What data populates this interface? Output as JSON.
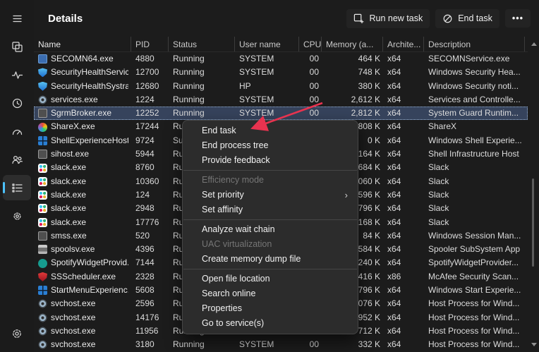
{
  "colors": {
    "accent": "#4cc2ff",
    "selection": "#36435c",
    "annotation_arrow": "#e8334f",
    "menu_bg": "#2c2c2c"
  },
  "header": {
    "title": "Details",
    "run_new_task_label": "Run new task",
    "end_task_label": "End task",
    "more_label": "•••"
  },
  "sidebar": {
    "items": [
      "menu-icon",
      "processes-icon",
      "performance-icon",
      "app-history-icon",
      "startup-apps-icon",
      "users-icon",
      "details-icon",
      "services-icon",
      "settings-icon"
    ],
    "active_item": "details-icon"
  },
  "table": {
    "columns": [
      {
        "key": "name",
        "label": "Name"
      },
      {
        "key": "pid",
        "label": "PID"
      },
      {
        "key": "status",
        "label": "Status"
      },
      {
        "key": "user",
        "label": "User name"
      },
      {
        "key": "cpu",
        "label": "CPU"
      },
      {
        "key": "mem",
        "label": "Memory (a..."
      },
      {
        "key": "arch",
        "label": "Archite..."
      },
      {
        "key": "desc",
        "label": "Description"
      }
    ],
    "rows": [
      {
        "icon": "speaker",
        "name": "SECOMN64.exe",
        "pid": "4880",
        "status": "Running",
        "user": "SYSTEM",
        "cpu": "00",
        "mem": "464 K",
        "arch": "x64",
        "desc": "SECOMNService.exe"
      },
      {
        "icon": "shield",
        "name": "SecurityHealthServic...",
        "pid": "12700",
        "status": "Running",
        "user": "SYSTEM",
        "cpu": "00",
        "mem": "748 K",
        "arch": "x64",
        "desc": "Windows Security Hea..."
      },
      {
        "icon": "shield",
        "name": "SecurityHealthSystra...",
        "pid": "12680",
        "status": "Running",
        "user": "HP",
        "cpu": "00",
        "mem": "380 K",
        "arch": "x64",
        "desc": "Windows Security noti..."
      },
      {
        "icon": "gears",
        "name": "services.exe",
        "pid": "1224",
        "status": "Running",
        "user": "SYSTEM",
        "cpu": "00",
        "mem": "2,612 K",
        "arch": "x64",
        "desc": "Services and Controlle..."
      },
      {
        "icon": "generic",
        "name": "SgrmBroker.exe",
        "pid": "12252",
        "status": "Running",
        "user": "SYSTEM",
        "cpu": "00",
        "mem": "2,812 K",
        "arch": "x64",
        "desc": "System Guard Runtim...",
        "selected": true
      },
      {
        "icon": "sharex",
        "name": "ShareX.exe",
        "pid": "17244",
        "status": "Running",
        "user": "",
        "cpu": "",
        "mem": "808 K",
        "arch": "x64",
        "desc": "ShareX"
      },
      {
        "icon": "window",
        "name": "ShellExperienceHost...",
        "pid": "9724",
        "status": "Suspended",
        "user": "",
        "cpu": "",
        "mem": "0 K",
        "arch": "x64",
        "desc": "Windows Shell Experie..."
      },
      {
        "icon": "generic",
        "name": "sihost.exe",
        "pid": "5944",
        "status": "Running",
        "user": "",
        "cpu": "",
        "mem": "164 K",
        "arch": "x64",
        "desc": "Shell Infrastructure Host"
      },
      {
        "icon": "slack",
        "name": "slack.exe",
        "pid": "8760",
        "status": "Running",
        "user": "",
        "cpu": "",
        "mem": "684 K",
        "arch": "x64",
        "desc": "Slack"
      },
      {
        "icon": "slack",
        "name": "slack.exe",
        "pid": "10360",
        "status": "Running",
        "user": "",
        "cpu": "",
        "mem": "060 K",
        "arch": "x64",
        "desc": "Slack"
      },
      {
        "icon": "slack",
        "name": "slack.exe",
        "pid": "124",
        "status": "Running",
        "user": "",
        "cpu": "",
        "mem": "596 K",
        "arch": "x64",
        "desc": "Slack"
      },
      {
        "icon": "slack",
        "name": "slack.exe",
        "pid": "2948",
        "status": "Running",
        "user": "",
        "cpu": "",
        "mem": "796 K",
        "arch": "x64",
        "desc": "Slack"
      },
      {
        "icon": "slack",
        "name": "slack.exe",
        "pid": "17776",
        "status": "Running",
        "user": "",
        "cpu": "",
        "mem": "168 K",
        "arch": "x64",
        "desc": "Slack"
      },
      {
        "icon": "generic",
        "name": "smss.exe",
        "pid": "520",
        "status": "Running",
        "user": "",
        "cpu": "",
        "mem": "84 K",
        "arch": "x64",
        "desc": "Windows Session Man..."
      },
      {
        "icon": "printer",
        "name": "spoolsv.exe",
        "pid": "4396",
        "status": "Running",
        "user": "",
        "cpu": "",
        "mem": "584 K",
        "arch": "x64",
        "desc": "Spooler SubSystem App"
      },
      {
        "icon": "spotify",
        "name": "SpotifyWidgetProvid...",
        "pid": "7144",
        "status": "Running",
        "user": "",
        "cpu": "",
        "mem": "240 K",
        "arch": "x64",
        "desc": "SpotifyWidgetProvider..."
      },
      {
        "icon": "mcafee",
        "name": "SSScheduler.exe",
        "pid": "2328",
        "status": "Running",
        "user": "",
        "cpu": "",
        "mem": "416 K",
        "arch": "x86",
        "desc": "McAfee Security Scan..."
      },
      {
        "icon": "window",
        "name": "StartMenuExperienc...",
        "pid": "5608",
        "status": "Running",
        "user": "",
        "cpu": "",
        "mem": "796 K",
        "arch": "x64",
        "desc": "Windows Start Experie..."
      },
      {
        "icon": "gears",
        "name": "svchost.exe",
        "pid": "2596",
        "status": "Running",
        "user": "",
        "cpu": "",
        "mem": "076 K",
        "arch": "x64",
        "desc": "Host Process for Wind..."
      },
      {
        "icon": "gears",
        "name": "svchost.exe",
        "pid": "14176",
        "status": "Running",
        "user": "",
        "cpu": "",
        "mem": "952 K",
        "arch": "x64",
        "desc": "Host Process for Wind..."
      },
      {
        "icon": "gears",
        "name": "svchost.exe",
        "pid": "11956",
        "status": "Running",
        "user": "",
        "cpu": "",
        "mem": "712 K",
        "arch": "x64",
        "desc": "Host Process for Wind..."
      },
      {
        "icon": "gears",
        "name": "svchost.exe",
        "pid": "3180",
        "status": "Running",
        "user": "SYSTEM",
        "cpu": "00",
        "mem": "332 K",
        "arch": "x64",
        "desc": "Host Process for Wind..."
      }
    ]
  },
  "context_menu": {
    "submenu_glyph": "›",
    "items": [
      {
        "label": "End task",
        "enabled": true
      },
      {
        "label": "End process tree",
        "enabled": true
      },
      {
        "label": "Provide feedback",
        "enabled": true
      },
      {
        "type": "separator"
      },
      {
        "label": "Efficiency mode",
        "enabled": false
      },
      {
        "label": "Set priority",
        "enabled": true,
        "submenu": true
      },
      {
        "label": "Set affinity",
        "enabled": true
      },
      {
        "type": "separator"
      },
      {
        "label": "Analyze wait chain",
        "enabled": true
      },
      {
        "label": "UAC virtualization",
        "enabled": false
      },
      {
        "label": "Create memory dump file",
        "enabled": true
      },
      {
        "type": "separator"
      },
      {
        "label": "Open file location",
        "enabled": true
      },
      {
        "label": "Search online",
        "enabled": true
      },
      {
        "label": "Properties",
        "enabled": true
      },
      {
        "label": "Go to service(s)",
        "enabled": true
      }
    ]
  }
}
